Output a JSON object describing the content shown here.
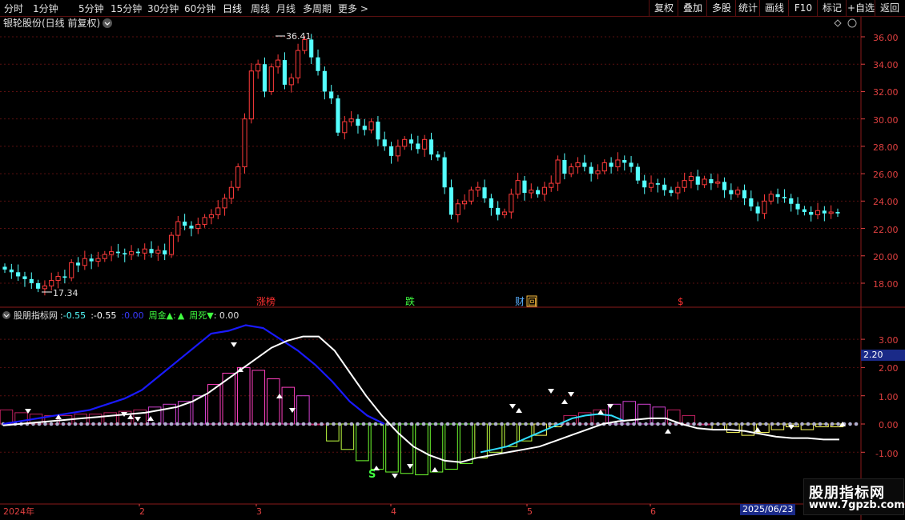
{
  "toolbar": {
    "periods": [
      "分时",
      "1分钟",
      "5分钟",
      "15分钟",
      "30分钟",
      "60分钟",
      "日线",
      "周线",
      "月线",
      "多周期",
      "更多 >"
    ],
    "active_period": "日线",
    "right_buttons": [
      "复权",
      "叠加",
      "多股",
      "统计",
      "画线",
      "F10",
      "标记",
      "+自选",
      "返回"
    ]
  },
  "price_panel": {
    "title": "银轮股份(日线 前复权)",
    "high_label": "36.41",
    "low_label": "17.34",
    "y_ticks": [
      "36.00",
      "34.00",
      "32.00",
      "30.00",
      "28.00",
      "26.00",
      "24.00",
      "22.00",
      "20.00",
      "18.00"
    ],
    "markers": [
      {
        "text": "涨榜",
        "color": "#ff3030"
      },
      {
        "text": "跌",
        "color": "#40ff40"
      },
      {
        "text": "财",
        "color": "#5ab0ff"
      },
      {
        "text": "回",
        "color": "#ffc040"
      },
      {
        "text": "$",
        "color": "#ff3030"
      }
    ]
  },
  "indicator_panel": {
    "name": "股朋指标网",
    "v1_sep": ":",
    "v1": "-0.55",
    "v2_sep": ":",
    "v2": "-0.55",
    "v3_sep": ":",
    "v3": "0.00",
    "golden_label": "周金▲:",
    "golden_symbol": "▲",
    "death_label": "周死▼",
    "death_value": ": 0.00",
    "y_ticks": [
      "3.00",
      "2.00",
      "1.00",
      "0.00",
      "-1.00"
    ],
    "current_value": "2.20",
    "s_label": "S"
  },
  "x_axis": {
    "labels": [
      "2024年",
      "2",
      "3",
      "4",
      "5",
      "6"
    ],
    "cursor_date": "2025/06/23"
  },
  "watermark": {
    "title": "股朋指标网",
    "url": "www.7gpzb.com"
  },
  "colors": {
    "up": "#ff3b3b",
    "down": "#54ffff",
    "grid": "#5a1010",
    "axis_text": "#e04040",
    "line_fast": "#1a1aff",
    "line_slow": "#ffffff"
  },
  "chart_data": {
    "type": "candlestick",
    "close_prices": [
      19.0,
      18.8,
      18.5,
      18.3,
      18.0,
      17.6,
      17.8,
      18.2,
      18.5,
      18.4,
      19.5,
      19.3,
      19.8,
      19.6,
      19.8,
      20.1,
      20.3,
      20.2,
      20.1,
      20.3,
      20.2,
      20.5,
      20.2,
      20.4,
      20.1,
      21.5,
      22.5,
      22.2,
      22.0,
      22.3,
      22.8,
      23.0,
      23.5,
      24.2,
      25.0,
      26.5,
      30.0,
      33.5,
      34.0,
      32.0,
      33.8,
      34.3,
      32.5,
      33.0,
      35.0,
      35.8,
      34.5,
      33.5,
      32.0,
      31.5,
      29.0,
      29.8,
      30.0,
      29.5,
      29.2,
      29.8,
      28.5,
      28.0,
      27.3,
      28.0,
      28.5,
      28.2,
      27.8,
      28.5,
      27.4,
      27.2,
      25.0,
      23.0,
      23.8,
      24.0,
      24.8,
      25.0,
      24.2,
      23.5,
      23.0,
      23.2,
      24.5,
      25.5,
      24.6,
      24.8,
      24.5,
      25.0,
      25.3,
      27.0,
      26.0,
      26.5,
      26.8,
      26.5,
      26.0,
      26.2,
      26.8,
      26.5,
      27.0,
      26.8,
      26.5,
      25.5,
      25.0,
      25.3,
      25.2,
      24.8,
      24.6,
      25.0,
      25.5,
      25.8,
      25.2,
      25.6,
      25.3,
      25.4,
      24.8,
      24.5,
      24.8,
      24.2,
      23.6,
      23.1,
      24.0,
      24.5,
      24.3,
      24.2,
      23.8,
      23.4,
      23.2,
      23.0,
      23.3,
      23.1,
      23.2,
      23.1
    ],
    "indicator": {
      "white_line": [
        -0.05,
        0.0,
        0.05,
        0.1,
        0.15,
        0.2,
        0.25,
        0.3,
        0.35,
        0.4,
        0.5,
        0.6,
        0.8,
        1.1,
        1.5,
        1.9,
        2.3,
        2.7,
        2.95,
        3.1,
        3.1,
        2.6,
        1.8,
        1.0,
        0.3,
        -0.3,
        -0.8,
        -1.1,
        -1.3,
        -1.35,
        -1.2,
        -1.1,
        -1.0,
        -0.9,
        -0.8,
        -0.6,
        -0.4,
        -0.2,
        0.0,
        0.1,
        0.15,
        0.2,
        0.2,
        0.0,
        -0.15,
        -0.2,
        -0.2,
        -0.25,
        -0.35,
        -0.45,
        -0.5,
        -0.5,
        -0.55,
        -0.55
      ],
      "blue_line": [
        0.0,
        0.1,
        0.2,
        0.3,
        0.4,
        0.5,
        0.7,
        0.9,
        1.2,
        1.7,
        2.2,
        2.7,
        3.2,
        3.3,
        3.5,
        3.4,
        3.0,
        2.6,
        2.1,
        1.5,
        0.8,
        0.3,
        0.0
      ],
      "cyan_line": [
        -1.0,
        -0.9,
        -0.8,
        -0.6,
        -0.4,
        -0.2,
        0.0,
        0.2,
        0.3,
        0.35,
        0.3,
        0.1
      ],
      "histogram": [
        0.5,
        0.4,
        0.35,
        0.3,
        0.3,
        0.35,
        0.35,
        0.4,
        0.45,
        0.5,
        0.6,
        0.7,
        0.8,
        1.0,
        1.4,
        1.8,
        2.0,
        1.9,
        1.6,
        1.3,
        1.0,
        0.0,
        -0.6,
        -0.9,
        -1.3,
        -1.6,
        -1.7,
        -1.75,
        -1.8,
        -1.7,
        -1.6,
        -1.4,
        -1.2,
        -1.0,
        -0.8,
        -0.6,
        -0.4,
        -0.1,
        0.3,
        0.4,
        0.5,
        0.7,
        0.8,
        0.7,
        0.6,
        0.5,
        0.3,
        0.0,
        -0.2,
        -0.3,
        -0.4,
        -0.3,
        -0.2,
        -0.1,
        -0.2,
        -0.1,
        -0.1
      ]
    }
  }
}
